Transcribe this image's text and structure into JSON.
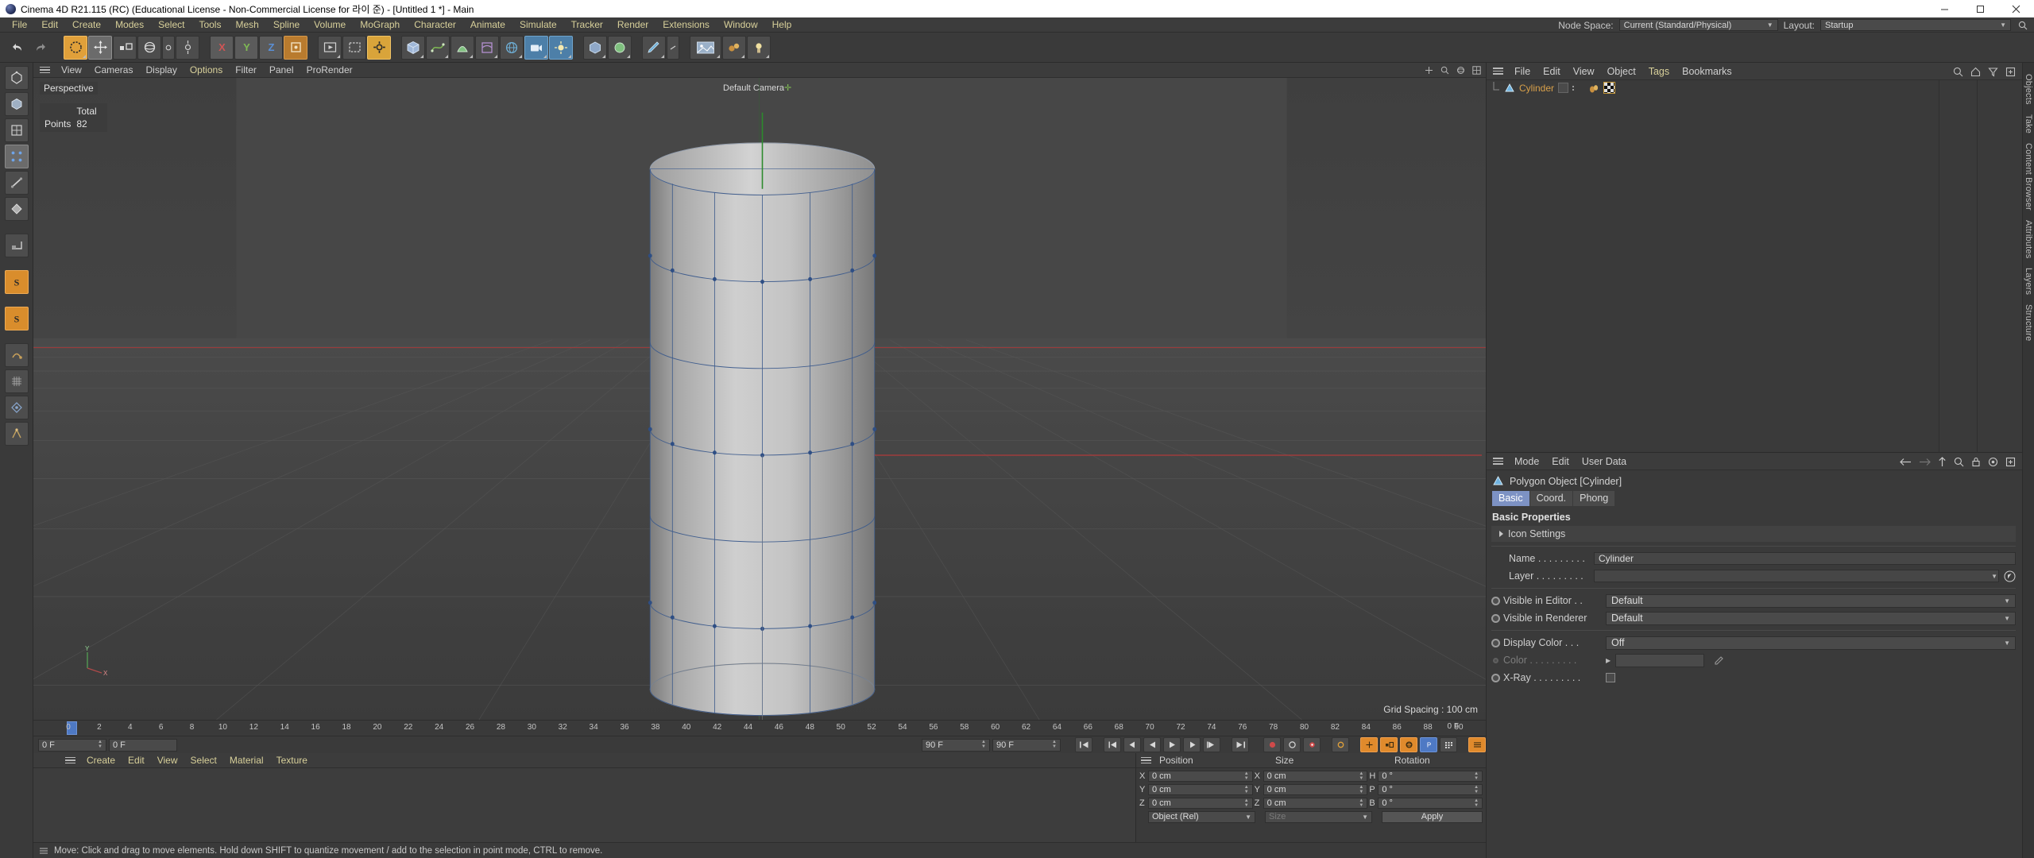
{
  "titlebar": {
    "title": "Cinema 4D R21.115 (RC) (Educational License - Non-Commercial License for 라이 준) - [Untitled 1 *] - Main",
    "minimize": "—",
    "maximize": "▢",
    "close": "✕"
  },
  "menubar": {
    "items": [
      "File",
      "Edit",
      "Create",
      "Modes",
      "Select",
      "Tools",
      "Mesh",
      "Spline",
      "Volume",
      "MoGraph",
      "Character",
      "Animate",
      "Simulate",
      "Tracker",
      "Render",
      "Extensions",
      "Window",
      "Help"
    ],
    "node_space_label": "Node Space:",
    "node_space_value": "Current (Standard/Physical)",
    "layout_label": "Layout:",
    "layout_value": "Startup"
  },
  "viewport": {
    "menu": [
      "View",
      "Cameras",
      "Display",
      "Options",
      "Filter",
      "Panel",
      "ProRender"
    ],
    "highlight_menu": "Options",
    "label": "Perspective",
    "camera_label": "Default Camera",
    "stats_header": "Total",
    "stats_rows": [
      {
        "name": "Points",
        "value": "82"
      }
    ],
    "grid_spacing": "Grid Spacing : 100 cm"
  },
  "timeline": {
    "ticks": [
      "0",
      "2",
      "4",
      "6",
      "8",
      "10",
      "12",
      "14",
      "16",
      "18",
      "20",
      "22",
      "24",
      "26",
      "28",
      "30",
      "32",
      "34",
      "36",
      "38",
      "40",
      "42",
      "44",
      "46",
      "48",
      "50",
      "52",
      "54",
      "56",
      "58",
      "60",
      "62",
      "64",
      "66",
      "68",
      "70",
      "72",
      "74",
      "76",
      "78",
      "80",
      "82",
      "84",
      "86",
      "88",
      "90"
    ],
    "end_marker": "0 F"
  },
  "transport": {
    "current_frame": "0 F",
    "start_frame": "0 F",
    "end_frame": "90 F",
    "preview_end": "90 F"
  },
  "material_manager": {
    "menu": [
      "Create",
      "Edit",
      "View",
      "Select",
      "Material",
      "Texture"
    ]
  },
  "coordinates": {
    "columns": [
      "Position",
      "Size",
      "Rotation"
    ],
    "position": {
      "x_label": "X",
      "x": "0 cm",
      "y_label": "Y",
      "y": "0 cm",
      "z_label": "Z",
      "z": "0 cm"
    },
    "size": {
      "x_label": "X",
      "x": "0 cm",
      "y_label": "Y",
      "y": "0 cm",
      "z_label": "Z",
      "z": "0 cm"
    },
    "rotation": {
      "h_label": "H",
      "h": "0 °",
      "p_label": "P",
      "p": "0 °",
      "b_label": "B",
      "b": "0 °"
    },
    "mode_select": "Object (Rel)",
    "size_select": "Size",
    "apply_button": "Apply"
  },
  "statusbar": {
    "message": "Move: Click and drag to move elements. Hold down SHIFT to quantize movement / add to the selection in point mode, CTRL to remove."
  },
  "object_manager": {
    "menu": [
      "File",
      "Edit",
      "View",
      "Object",
      "Tags",
      "Bookmarks"
    ],
    "highlight_menu": "Tags",
    "objects": [
      {
        "name": "Cylinder"
      }
    ]
  },
  "attribute_manager": {
    "menu": [
      "Mode",
      "Edit",
      "User Data"
    ],
    "object_header": "Polygon Object [Cylinder]",
    "tabs": [
      "Basic",
      "Coord.",
      "Phong"
    ],
    "active_tab": "Basic",
    "section_title": "Basic Properties",
    "fold_row": "Icon Settings",
    "fields": {
      "name_label": "Name . . . . . . . . .",
      "name_value": "Cylinder",
      "layer_label": "Layer . . . . . . . . .",
      "layer_value": "",
      "visible_editor_label": "Visible in Editor . .",
      "visible_editor_value": "Default",
      "visible_renderer_label": "Visible in Renderer",
      "visible_renderer_value": "Default",
      "display_color_label": "Display Color  . . .",
      "display_color_value": "Off",
      "color_label": "Color . . . . . . . . .",
      "xray_label": "X-Ray . . . . . . . . ."
    }
  },
  "vertical_tabs": [
    "Attributes",
    "Layers",
    "Structure"
  ],
  "right_edge_tabs": [
    "Objects",
    "Take",
    "Content Browser",
    "Structure"
  ],
  "colors": {
    "accent_blue": "#7d92c4",
    "menu_yellow": "#d8d09a",
    "object_orange": "#d8a04a",
    "panel_bg": "#3a3a3a",
    "viewport_bg": "#434343",
    "field_bg": "#4a4a4a"
  }
}
